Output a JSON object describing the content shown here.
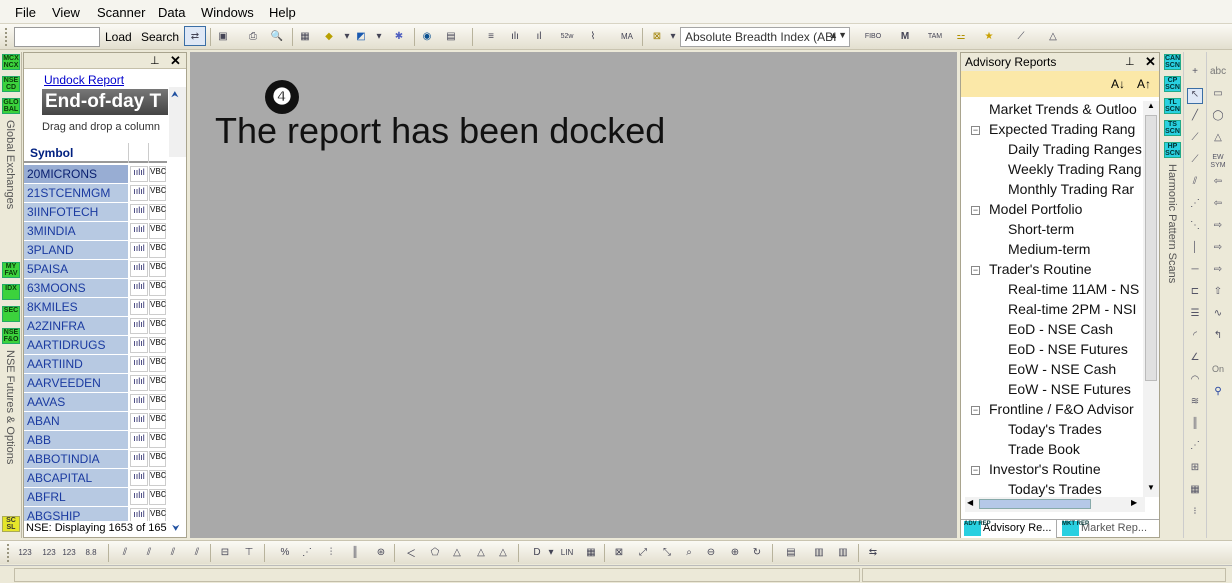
{
  "menu": [
    "File",
    "View",
    "Scanner",
    "Data",
    "Windows",
    "Help"
  ],
  "toolbar": {
    "symbol_value": "",
    "load_label": "Load",
    "search_label": "Search",
    "breadth_select": "Absolute Breadth Index (ABI"
  },
  "left_strip": {
    "badges_top": [
      "MCX NCX",
      "NSE CD",
      "GLO BAL"
    ],
    "label_top": "Global Exchanges",
    "badges_mid": [
      "MY FAV",
      "IDX",
      "SEC",
      "NSE F&O"
    ],
    "label_mid": "NSE Futures & Options",
    "badge_bottom": "SC SL"
  },
  "left_panel": {
    "undock_label": "Undock Report",
    "banner": "End-of-day T",
    "drag_hint": "Drag and drop a column",
    "column_header": "Symbol",
    "chart_glyph": "ıılıl",
    "vbc_label": "VBC",
    "symbols": [
      "20MICRONS",
      "21STCENMGM",
      "3IINFOTECH",
      "3MINDIA",
      "3PLAND",
      "5PAISA",
      "63MOONS",
      "8KMILES",
      "A2ZINFRA",
      "AARTIDRUGS",
      "AARTIIND",
      "AARVEEDEN",
      "AAVAS",
      "ABAN",
      "ABB",
      "ABBOTINDIA",
      "ABCAPITAL",
      "ABFRL",
      "ABGSHIP"
    ],
    "status": "NSE: Displaying 1653 of 165"
  },
  "center": {
    "marker": "❹",
    "message": "The report has been docked"
  },
  "advisory": {
    "title": "Advisory Reports",
    "font_down": "A↓",
    "font_up": "A↑",
    "tree": [
      {
        "label": "Market Trends & Outloo",
        "level": 0,
        "expander": ""
      },
      {
        "label": "Expected Trading Rang",
        "level": 0,
        "expander": "−"
      },
      {
        "label": "Daily Trading Ranges",
        "level": 1,
        "expander": ""
      },
      {
        "label": "Weekly Trading Rang",
        "level": 1,
        "expander": ""
      },
      {
        "label": "Monthly Trading Rar",
        "level": 1,
        "expander": ""
      },
      {
        "label": "Model Portfolio",
        "level": 0,
        "expander": "−"
      },
      {
        "label": "Short-term",
        "level": 1,
        "expander": ""
      },
      {
        "label": "Medium-term",
        "level": 1,
        "expander": ""
      },
      {
        "label": "Trader's Routine",
        "level": 0,
        "expander": "−"
      },
      {
        "label": "Real-time 11AM - NS",
        "level": 1,
        "expander": ""
      },
      {
        "label": "Real-time 2PM - NSI",
        "level": 1,
        "expander": ""
      },
      {
        "label": "EoD - NSE Cash",
        "level": 1,
        "expander": ""
      },
      {
        "label": "EoD - NSE Futures",
        "level": 1,
        "expander": ""
      },
      {
        "label": "EoW - NSE Cash",
        "level": 1,
        "expander": ""
      },
      {
        "label": "EoW - NSE Futures",
        "level": 1,
        "expander": ""
      },
      {
        "label": "Frontline / F&O Advisor",
        "level": 0,
        "expander": "−"
      },
      {
        "label": "Today's Trades",
        "level": 1,
        "expander": ""
      },
      {
        "label": "Trade Book",
        "level": 1,
        "expander": ""
      },
      {
        "label": "Investor's Routine",
        "level": 0,
        "expander": "−"
      },
      {
        "label": "Today's Trades",
        "level": 1,
        "expander": ""
      }
    ],
    "tabs": [
      {
        "badge": "ADV REP",
        "label": "Advisory Re..."
      },
      {
        "badge": "MKT REP",
        "label": "Market Rep..."
      }
    ]
  },
  "right_strip": {
    "scan_badges": [
      "CAN SCN",
      "CP SCN",
      "TL SCN",
      "TS SCN",
      "HP SCN"
    ],
    "scan_label": "Harmonic Pattern Scans"
  },
  "drawing_tools": {
    "text_tool": "abc",
    "ew_label": "EW SYM",
    "on_label": "On"
  }
}
